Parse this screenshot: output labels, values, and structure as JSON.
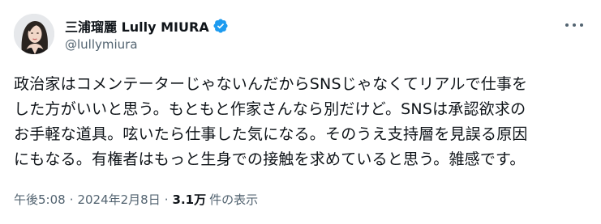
{
  "tweet": {
    "author": {
      "display_name": "三浦瑠麗 Lully MIURA",
      "handle": "@lullymiura"
    },
    "body_lines": [
      "政治家はコメンテーターじゃないんだからSNSじゃなくてリアルで仕事を",
      "した方がいいと思う。もともと作家さんなら別だけど。SNSは承認欲求の",
      "お手軽な道具。呟いたら仕事した気になる。そのうえ支持層を見誤る原因",
      "にもなる。有権者はもっと生身での接触を求めていると思う。雑感です。"
    ],
    "meta": {
      "time": "午後5:08",
      "separator": "·",
      "date": "2024年2月8日",
      "views_count": "3.1万",
      "views_label": "件の表示"
    },
    "icons": {
      "verified": "verified-badge-icon",
      "more": "more-options-icon"
    },
    "colors": {
      "verified_blue": "#1d9bf0",
      "text_primary": "#0f1419",
      "text_secondary": "#536471"
    }
  }
}
